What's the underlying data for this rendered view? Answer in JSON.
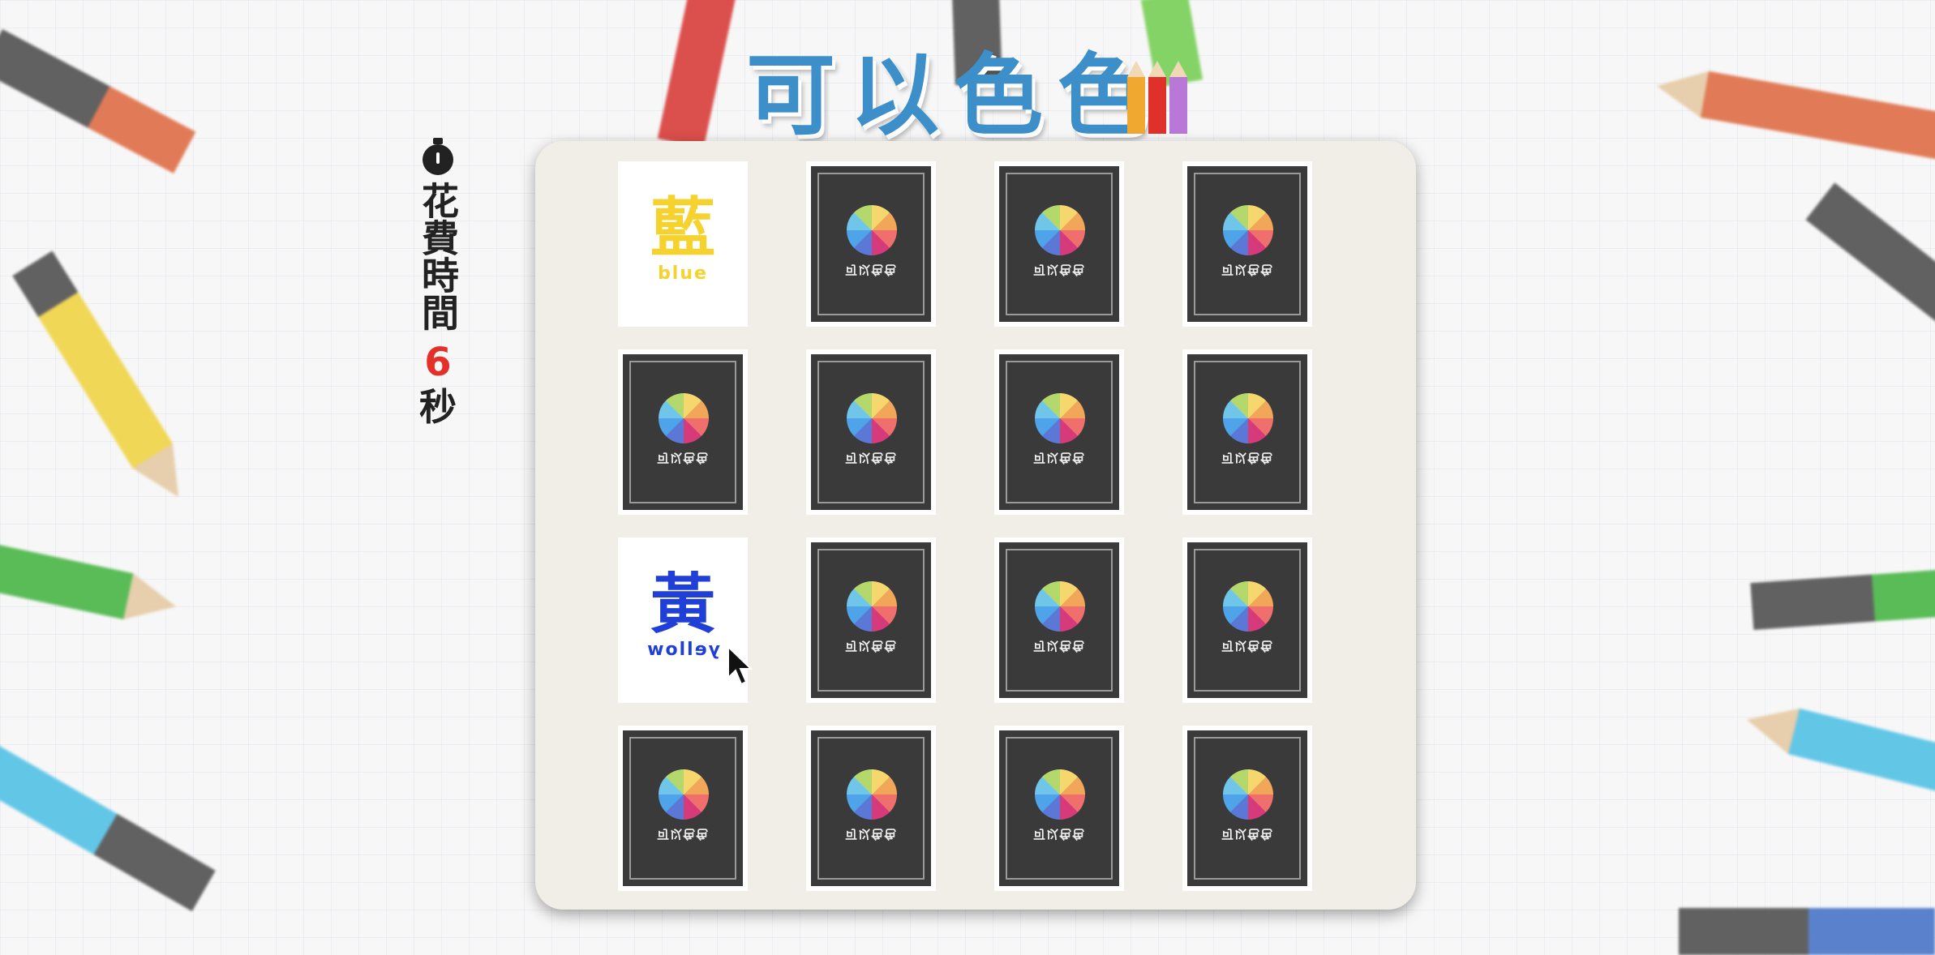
{
  "title": "可以色色",
  "title_pencil_colors": [
    "#f0a830",
    "#e0302a",
    "#b878d8"
  ],
  "timer": {
    "icon": "stopwatch-icon",
    "label": "花費時間",
    "value": "6",
    "unit": "秒"
  },
  "card_back": {
    "brand": "可以色色",
    "icon": "color-wheel-icon"
  },
  "grid": {
    "rows": 4,
    "cols": 4,
    "cards": [
      {
        "state": "face",
        "glyph": "藍",
        "word": "blue",
        "color": "#f5d22e",
        "word_mirrored": false
      },
      {
        "state": "back"
      },
      {
        "state": "back"
      },
      {
        "state": "back"
      },
      {
        "state": "back"
      },
      {
        "state": "back"
      },
      {
        "state": "back"
      },
      {
        "state": "back"
      },
      {
        "state": "face",
        "glyph": "黃",
        "word": "yellow",
        "color": "#1f3fd6",
        "word_mirrored": true
      },
      {
        "state": "back"
      },
      {
        "state": "back"
      },
      {
        "state": "back"
      },
      {
        "state": "back"
      },
      {
        "state": "back"
      },
      {
        "state": "back"
      },
      {
        "state": "back"
      }
    ]
  }
}
